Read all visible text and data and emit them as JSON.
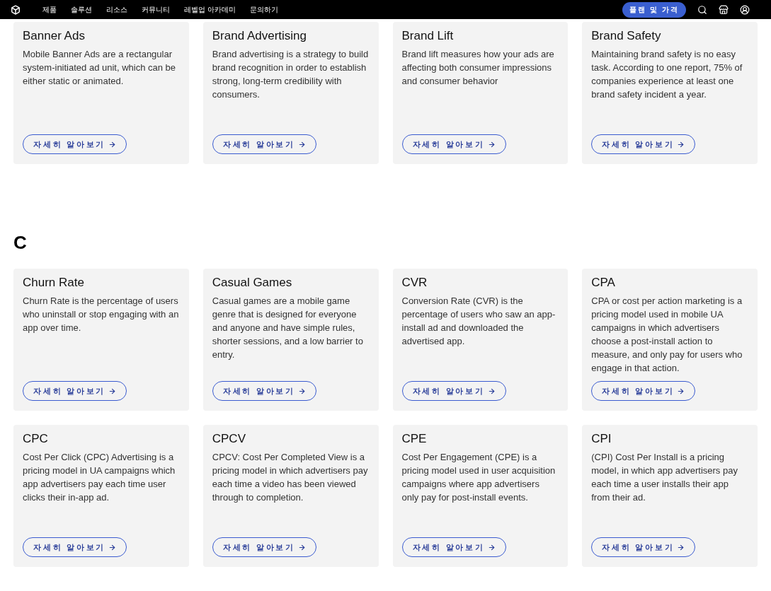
{
  "nav": {
    "links": [
      "제품",
      "솔루션",
      "리소스",
      "커뮤니티",
      "레벨업 아카데미",
      "문의하기"
    ],
    "cta": "플랜 및 가격"
  },
  "sections": [
    {
      "cards": [
        {
          "title": "Banner Ads",
          "description": "Mobile Banner Ads are a rectangular system-initiated ad unit, which can be either static or animated.",
          "button": "자세히 알아보기"
        },
        {
          "title": "Brand Advertising",
          "description": "Brand advertising is a strategy to build brand recognition in order to establish strong, long-term credibility with consumers.",
          "button": "자세히 알아보기"
        },
        {
          "title": "Brand Lift",
          "description": "Brand lift measures how your ads are affecting both consumer impressions and consumer behavior",
          "button": "자세히 알아보기"
        },
        {
          "title": "Brand Safety",
          "description": "Maintaining brand safety is no easy task. According to one report, 75% of companies experience at least one brand safety incident a year.",
          "button": "자세히 알아보기"
        }
      ]
    },
    {
      "heading": "C",
      "cards": [
        {
          "title": "Churn Rate",
          "description": "Churn Rate is the percentage of users who uninstall or stop engaging with an app over time.",
          "button": "자세히 알아보기"
        },
        {
          "title": "Casual Games",
          "description": "Casual games are a mobile game genre that is designed for everyone and anyone and have simple rules, shorter sessions, and a low barrier to entry.",
          "button": "자세히 알아보기"
        },
        {
          "title": "CVR",
          "description": "Conversion Rate (CVR) is the percentage of users who saw an app-install ad and downloaded the advertised app.",
          "button": "자세히 알아보기"
        },
        {
          "title": "CPA",
          "description": "CPA or cost per action marketing is a pricing model used in mobile UA campaigns in which advertisers choose a post-install action to measure, and only pay for users who engage in that action.",
          "button": "자세히 알아보기"
        },
        {
          "title": "CPC",
          "description": "Cost Per Click (CPC) Advertising is a pricing model in UA campaigns which app advertisers pay each time user clicks their in-app ad.",
          "button": "자세히 알아보기"
        },
        {
          "title": "CPCV",
          "description": "CPCV: Cost Per Completed View is a pricing model in which advertisers pay each time a video has been viewed through to completion.",
          "button": "자세히 알아보기"
        },
        {
          "title": "CPE",
          "description": "Cost Per Engagement (CPE) is a pricing model used in user acquisition campaigns where app advertisers only pay for post-install events.",
          "button": "자세히 알아보기"
        },
        {
          "title": "CPI",
          "description": "(CPI) Cost Per Install is a pricing model, in which app advertisers pay each time a user installs their app from their ad.",
          "button": "자세히 알아보기"
        }
      ]
    }
  ]
}
